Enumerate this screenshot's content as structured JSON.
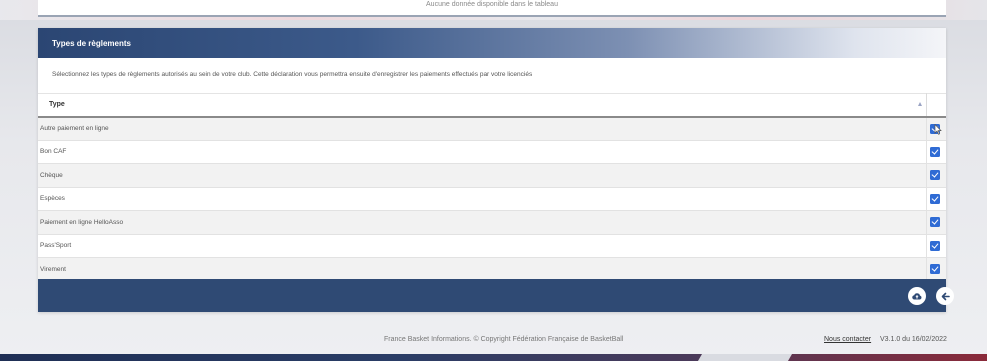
{
  "previous_section": {
    "empty_message": "Aucune donnée disponible dans le tableau"
  },
  "section": {
    "title": "Types de règlements",
    "description": "Sélectionnez les types de règlements autorisés au sein de votre club. Cette déclaration vous permettra ensuite d'enregistrer les paiements effectués par votre licenciés"
  },
  "table": {
    "header_type": "Type",
    "rows": [
      {
        "label": "Autre paiement en ligne",
        "checked": true
      },
      {
        "label": "Bon CAF",
        "checked": true
      },
      {
        "label": "Chèque",
        "checked": true
      },
      {
        "label": "Espèces",
        "checked": true
      },
      {
        "label": "Paiement en ligne HelloAsso",
        "checked": true
      },
      {
        "label": "Pass'Sport",
        "checked": true
      },
      {
        "label": "Virement",
        "checked": true
      }
    ]
  },
  "icons": {
    "save": "cloud-upload-icon",
    "back": "arrow-left-icon",
    "cursor": "mouse-pointer-icon",
    "sort": "sort-ascending-icon"
  },
  "colors": {
    "header_blue": "#2b4673",
    "footer_blue": "#2f4a74",
    "checkbox_blue": "#2f6bd4"
  },
  "footer": {
    "copyright": "France Basket Informations. © Copyright Fédération Française de BasketBall",
    "contact": "Nous contacter",
    "version": "V3.1.0 du 16/02/2022"
  }
}
